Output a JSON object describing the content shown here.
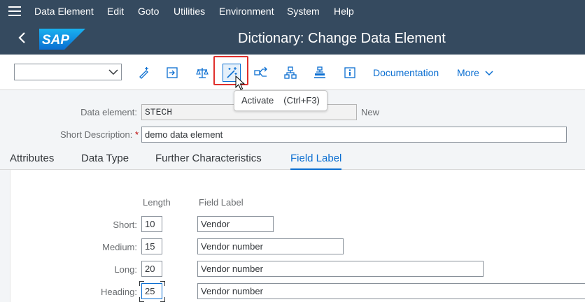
{
  "menubar": {
    "items": [
      "Data Element",
      "Edit",
      "Goto",
      "Utilities",
      "Environment",
      "System",
      "Help"
    ]
  },
  "titlebar": {
    "logo_text": "SAP",
    "title": "Dictionary: Change Data Element"
  },
  "toolbar": {
    "command_field_value": "",
    "buttons": [
      "display-change-icon",
      "other-object-icon",
      "check-icon",
      "activate-icon",
      "where-used-icon",
      "object-list-icon",
      "hierarchy-icon",
      "info-icon"
    ],
    "documentation_label": "Documentation",
    "more_label": "More"
  },
  "tooltip": {
    "label": "Activate",
    "shortcut": "(Ctrl+F3)"
  },
  "form": {
    "data_element_label": "Data element:",
    "data_element_value": "STECH",
    "status": "New",
    "short_description_label": "Short Description:",
    "required_marker": "*",
    "short_description_value": "demo data element"
  },
  "tabs": [
    "Attributes",
    "Data Type",
    "Further Characteristics",
    "Field Label"
  ],
  "active_tab": "Field Label",
  "field_labels": {
    "length_header": "Length",
    "label_header": "Field Label",
    "rows": [
      {
        "name": "Short:",
        "length": "10",
        "label": "Vendor"
      },
      {
        "name": "Medium:",
        "length": "15",
        "label": "Vendor number"
      },
      {
        "name": "Long:",
        "length": "20",
        "label": "Vendor number"
      },
      {
        "name": "Heading:",
        "length": "25",
        "label": "Vendor number"
      }
    ]
  },
  "colors": {
    "shell": "#354a5f",
    "accent": "#0a6ed1",
    "highlight": "#e0302c"
  }
}
